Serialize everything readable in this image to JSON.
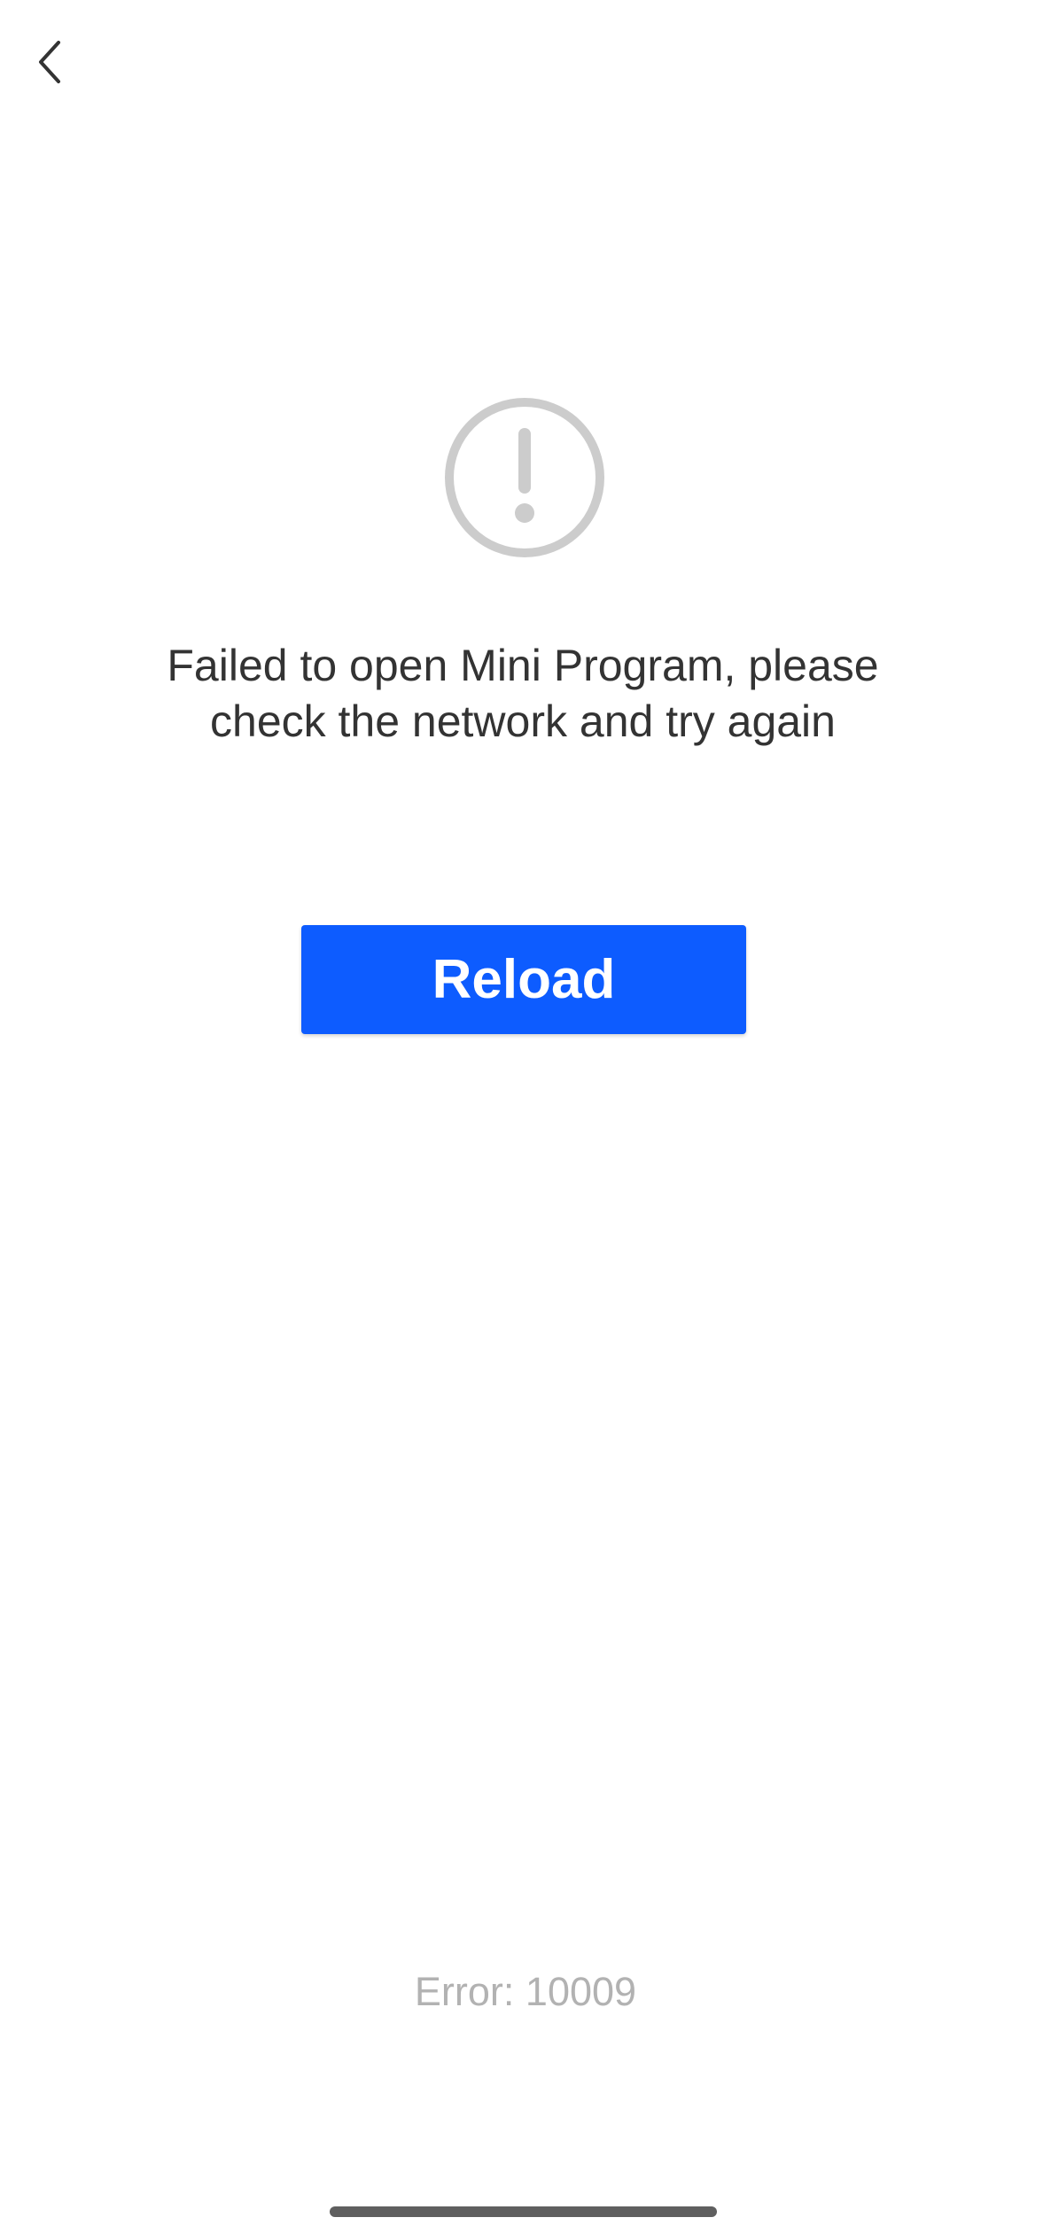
{
  "error_page": {
    "message": "Failed to open Mini Program, please check the network and try again",
    "reload_label": "Reload",
    "error_code": "Error: 10009"
  },
  "icons": {
    "back": "chevron-left-icon",
    "alert": "exclamation-circle-icon"
  },
  "colors": {
    "background": "#ffffff",
    "primary_button": "#0d5cff",
    "button_text": "#ffffff",
    "message_text": "#333333",
    "error_code_text": "#b2b2b2",
    "icon_gray": "#cccccc",
    "back_icon": "#333333",
    "home_indicator": "#5f5f5f"
  }
}
